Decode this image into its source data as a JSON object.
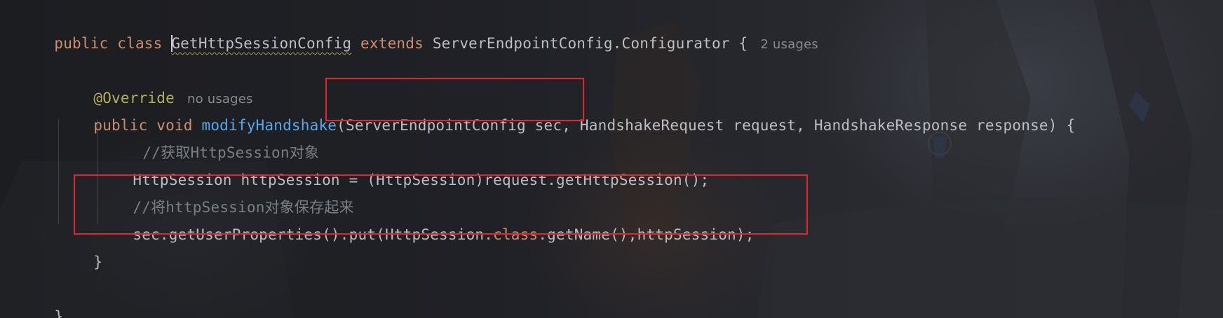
{
  "editor": {
    "lines": [
      {
        "tokens": [
          {
            "text": "public class ",
            "kind": "keyword"
          },
          {
            "text": "GetHttpSessionConfig",
            "kind": "classname"
          },
          {
            "text": " extends ",
            "kind": "keyword"
          },
          {
            "text": "ServerEndpointConfig.Configurator {",
            "kind": "plain"
          }
        ],
        "hint": "2 usages"
      },
      {
        "tokens": [
          {
            "text": "@Override",
            "kind": "annotation"
          }
        ],
        "hint": "no usages"
      },
      {
        "tokens": [
          {
            "text": "public void ",
            "kind": "keyword"
          },
          {
            "text": "modifyHandshake",
            "kind": "function"
          },
          {
            "text": "(ServerEndpointConfig sec, HandshakeRequest request, HandshakeResponse response) {",
            "kind": "plain"
          }
        ]
      },
      {
        "tokens": [
          {
            "text": "//获取HttpSession对象",
            "kind": "comment"
          }
        ]
      },
      {
        "tokens": [
          {
            "text": "HttpSession httpSession = (HttpSession)request.getHttpSession();",
            "kind": "plain"
          }
        ]
      },
      {
        "tokens": [
          {
            "text": "//将httpSession对象保存起来",
            "kind": "comment"
          }
        ]
      },
      {
        "tokens": [
          {
            "text": "sec.getUserProperties().put(HttpSession.",
            "kind": "plain"
          },
          {
            "text": "class",
            "kind": "keyword"
          },
          {
            "text": ".getName(),httpSession);",
            "kind": "plain"
          }
        ]
      },
      {
        "tokens": [
          {
            "text": "}",
            "kind": "plain"
          }
        ]
      },
      {
        "tokens": [
          {
            "text": "}",
            "kind": "plain"
          }
        ]
      }
    ]
  },
  "colors": {
    "background": "#1e1f22",
    "keyword": "#cf8e6d",
    "function": "#56a8f5",
    "annotation": "#b3ae60",
    "comment": "#7a7e85",
    "plain": "#bcbec4",
    "hint": "#868a91",
    "highlight_box": "#e0252f"
  }
}
